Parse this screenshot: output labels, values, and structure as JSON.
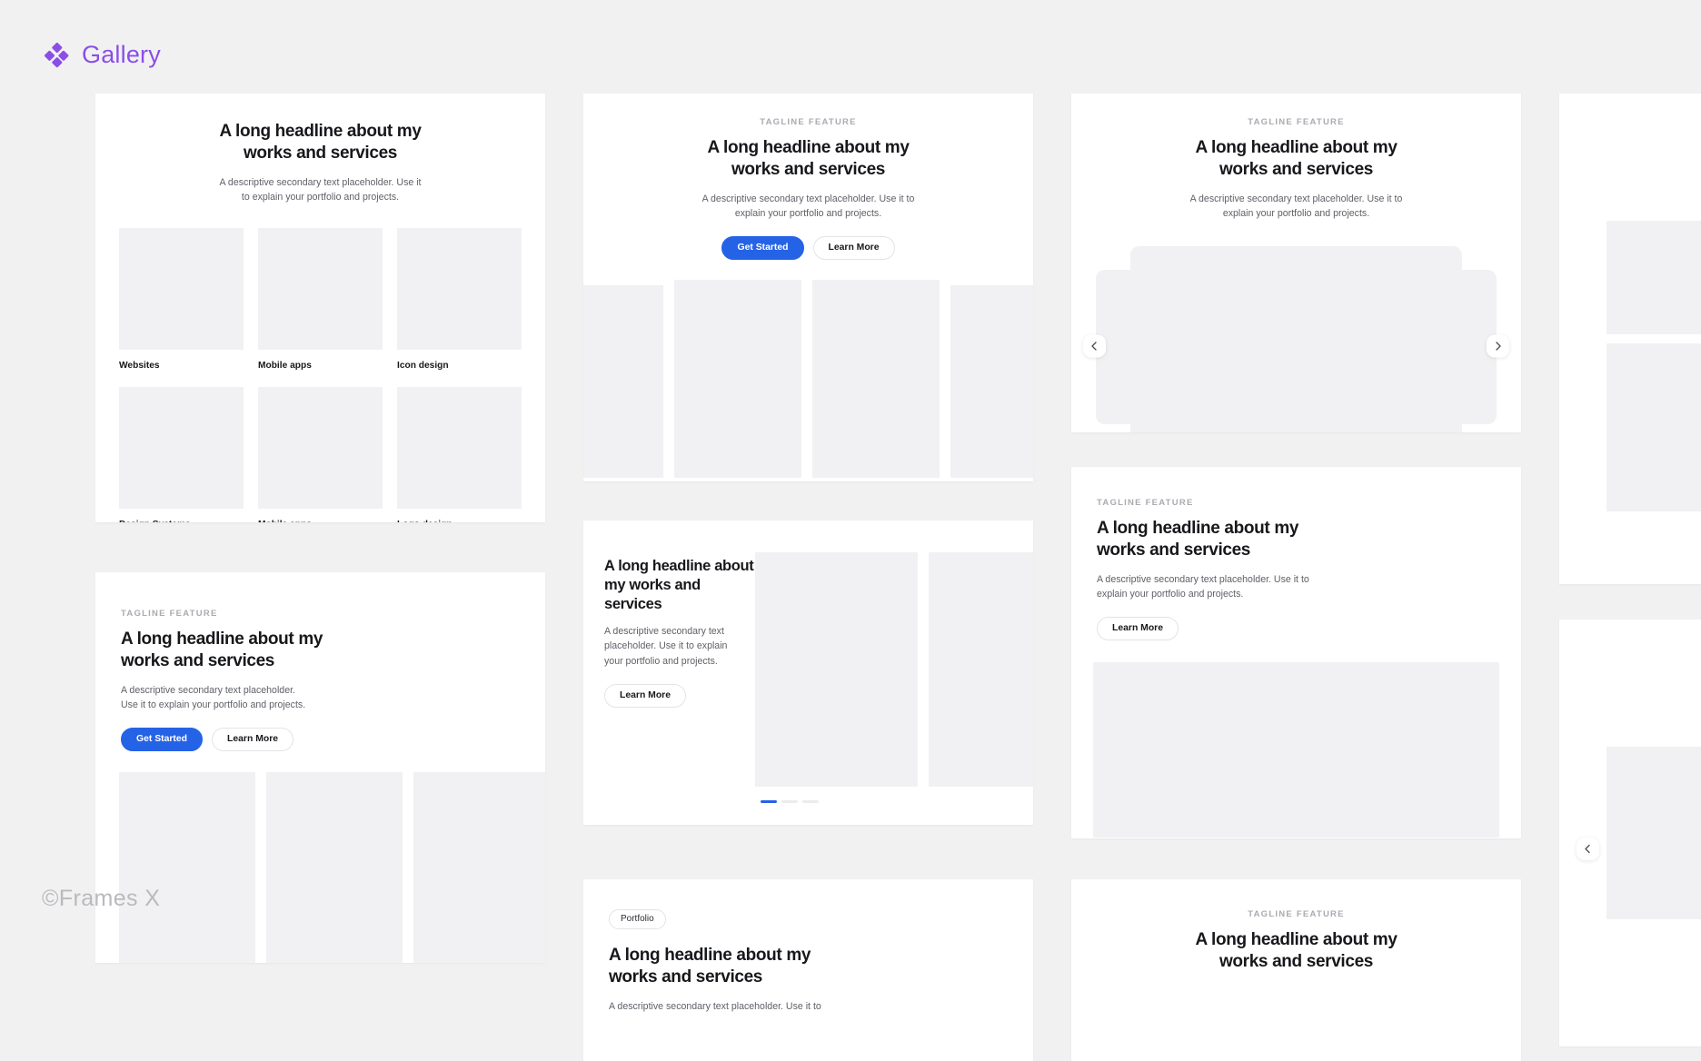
{
  "brand": {
    "name": "Gallery",
    "logo_icon": "diamond-cluster-icon",
    "color": "#8b4ee8"
  },
  "watermark": "©Frames X",
  "common": {
    "tagline": "TAGLINE FEATURE",
    "headline_line1": "A long headline about my",
    "headline_line2": "works and services",
    "headline_full": "A long headline about my works and services",
    "subtext": "A descriptive secondary text placeholder. Use it to explain your portfolio and projects.",
    "subtext_narrow": "A descriptive secondary text placeholder. Use it to explain your portfolio and projects.",
    "btn_primary": "Get Started",
    "btn_secondary": "Learn More",
    "badge": "Portfolio",
    "prev_icon": "chevron-left-icon",
    "next_icon": "chevron-right-icon",
    "accent": "#2563e6",
    "placeholder_fill": "#f1f1f3"
  },
  "cards": {
    "grid_gallery": {
      "headline_line1": "A long headline about my",
      "headline_line2": "works and services",
      "subtext": "A descriptive secondary text placeholder. Use it to explain your portfolio and projects.",
      "tiles": [
        {
          "caption": "Websites"
        },
        {
          "caption": "Mobile apps"
        },
        {
          "caption": "Icon design"
        },
        {
          "caption": "Design Systems"
        },
        {
          "caption": "Mobile apps"
        },
        {
          "caption": "Logo design"
        }
      ]
    },
    "hero_carousel": {
      "tagline": "TAGLINE FEATURE",
      "headline_line1": "A long headline about my",
      "headline_line2": "works and services",
      "subtext": "A descriptive secondary text placeholder. Use it to explain your portfolio and projects.",
      "btn_primary": "Get Started",
      "btn_secondary": "Learn More",
      "dots_total": 3,
      "dots_active_index": 0
    },
    "coverflow": {
      "tagline": "TAGLINE FEATURE",
      "headline_line1": "A long headline about my",
      "headline_line2": "works and services",
      "subtext": "A descriptive secondary text placeholder. Use it to explain your portfolio and projects.",
      "prev_label": "Previous slide",
      "next_label": "Next slide"
    },
    "split_media": {
      "headline_line1": "A long headline about",
      "headline_line2": "my works and services",
      "subtext": "A descriptive secondary text placeholder. Use it to explain your portfolio and projects.",
      "btn_secondary": "Learn More",
      "dots_total": 3,
      "dots_active_index": 0
    },
    "left_media": {
      "tagline": "TAGLINE FEATURE",
      "headline_line1": "A long headline about my",
      "headline_line2": "works and services",
      "subtext": "A descriptive secondary text placeholder. Use it to explain your portfolio and projects.",
      "btn_secondary": "Learn More",
      "prev_label": "Previous slide",
      "next_label": "Next slide"
    },
    "grid_b": {
      "tagline": "TAGLINE FEATURE",
      "headline_line1": "A long headline about my",
      "headline_line2": "works and services",
      "subtext": "A descriptive secondary text placeholder. Use it to explain your portfolio and projects.",
      "btn_primary": "Get Started",
      "btn_secondary": "Learn More",
      "prev_label": "Previous slide",
      "next_label": "Next slide"
    },
    "badge_card": {
      "badge": "Portfolio",
      "headline_line1": "A long headline about my",
      "headline_line2": "works and services",
      "subtext": "A descriptive secondary text placeholder. Use it to"
    },
    "bottom_card": {
      "tagline": "TAGLINE FEATURE",
      "headline_line1": "A long headline about my",
      "headline_line2": "works and services"
    }
  }
}
